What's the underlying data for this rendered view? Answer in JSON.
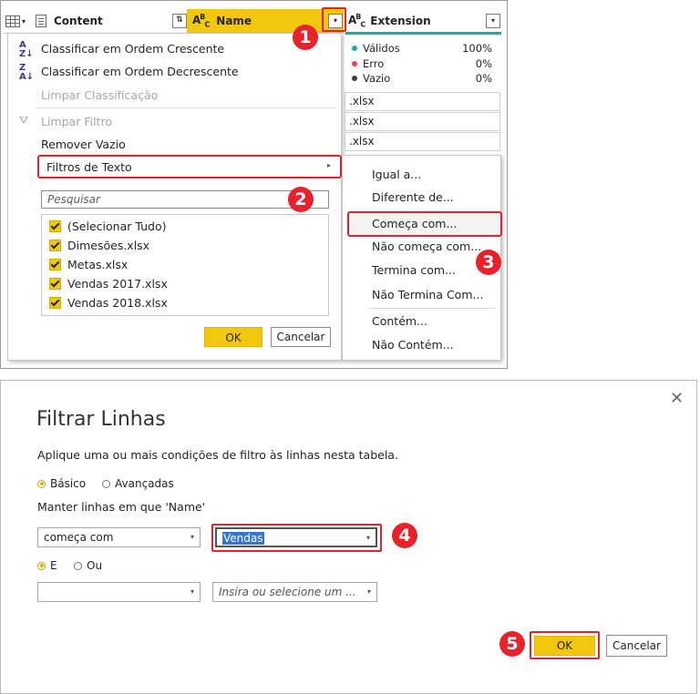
{
  "top_panel": {
    "columns": [
      {
        "label": "Content"
      },
      {
        "label": "Name"
      },
      {
        "label": "Extension"
      }
    ],
    "menu": {
      "sort_asc": "Classificar em Ordem Crescente",
      "sort_desc": "Classificar em Ordem Decrescente",
      "clear_sort": "Limpar Classificação",
      "clear_filter": "Limpar Filtro",
      "remove_empty": "Remover Vazio",
      "text_filters": "Filtros de Texto",
      "search_placeholder": "Pesquisar",
      "checklist": [
        "(Selecionar Tudo)",
        "Dimesões.xlsx",
        "Metas.xlsx",
        "Vendas 2017.xlsx",
        "Vendas 2018.xlsx"
      ],
      "ok": "OK",
      "cancel": "Cancelar"
    },
    "profile": [
      {
        "label": "Válidos",
        "value": "100%",
        "color": "#16b0a5"
      },
      {
        "label": "Erro",
        "value": "0%",
        "color": "#e8474f"
      },
      {
        "label": "Vazio",
        "value": "0%",
        "color": "#3b3b3b"
      }
    ],
    "extension_rows": [
      ".xlsx",
      ".xlsx",
      ".xlsx"
    ],
    "text_filter_submenu": [
      "Igual a...",
      "Diferente de...",
      "Começa com...",
      "Não começa com...",
      "Termina com...",
      "Não Termina Com...",
      "Contém...",
      "Não Contém..."
    ]
  },
  "badges": [
    "1",
    "2",
    "3",
    "4",
    "5"
  ],
  "dialog": {
    "title": "Filtrar Linhas",
    "close_glyph": "✕",
    "description": "Aplique uma ou mais condições de filtro às linhas nesta tabela.",
    "mode_basic": "Básico",
    "mode_advanced": "Avançadas",
    "keep_rows_label": "Manter linhas em que 'Name'",
    "operator_1": "começa com",
    "value_1": "Vendas",
    "logic_and": "E",
    "logic_or": "Ou",
    "operator_2": "",
    "value_2_placeholder": "Insira ou selecione um ...",
    "ok": "OK",
    "cancel": "Cancelar"
  },
  "colors": {
    "accent_yellow": "#f2c80f",
    "highlight_red": "#e8212b",
    "quality_teal": "#16b0a5",
    "selection_blue": "#3178d3"
  }
}
